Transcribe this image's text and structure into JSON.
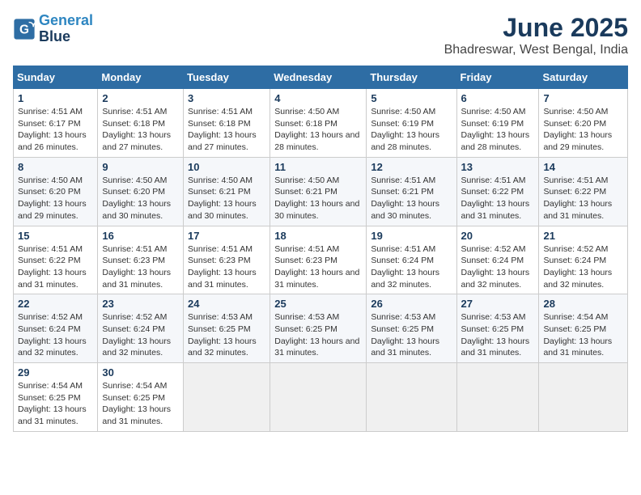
{
  "logo": {
    "line1": "General",
    "line2": "Blue"
  },
  "title": "June 2025",
  "subtitle": "Bhadreswar, West Bengal, India",
  "days_of_week": [
    "Sunday",
    "Monday",
    "Tuesday",
    "Wednesday",
    "Thursday",
    "Friday",
    "Saturday"
  ],
  "weeks": [
    [
      {
        "day": "1",
        "sunrise": "Sunrise: 4:51 AM",
        "sunset": "Sunset: 6:17 PM",
        "daylight": "Daylight: 13 hours and 26 minutes."
      },
      {
        "day": "2",
        "sunrise": "Sunrise: 4:51 AM",
        "sunset": "Sunset: 6:18 PM",
        "daylight": "Daylight: 13 hours and 27 minutes."
      },
      {
        "day": "3",
        "sunrise": "Sunrise: 4:51 AM",
        "sunset": "Sunset: 6:18 PM",
        "daylight": "Daylight: 13 hours and 27 minutes."
      },
      {
        "day": "4",
        "sunrise": "Sunrise: 4:50 AM",
        "sunset": "Sunset: 6:18 PM",
        "daylight": "Daylight: 13 hours and 28 minutes."
      },
      {
        "day": "5",
        "sunrise": "Sunrise: 4:50 AM",
        "sunset": "Sunset: 6:19 PM",
        "daylight": "Daylight: 13 hours and 28 minutes."
      },
      {
        "day": "6",
        "sunrise": "Sunrise: 4:50 AM",
        "sunset": "Sunset: 6:19 PM",
        "daylight": "Daylight: 13 hours and 28 minutes."
      },
      {
        "day": "7",
        "sunrise": "Sunrise: 4:50 AM",
        "sunset": "Sunset: 6:20 PM",
        "daylight": "Daylight: 13 hours and 29 minutes."
      }
    ],
    [
      {
        "day": "8",
        "sunrise": "Sunrise: 4:50 AM",
        "sunset": "Sunset: 6:20 PM",
        "daylight": "Daylight: 13 hours and 29 minutes."
      },
      {
        "day": "9",
        "sunrise": "Sunrise: 4:50 AM",
        "sunset": "Sunset: 6:20 PM",
        "daylight": "Daylight: 13 hours and 30 minutes."
      },
      {
        "day": "10",
        "sunrise": "Sunrise: 4:50 AM",
        "sunset": "Sunset: 6:21 PM",
        "daylight": "Daylight: 13 hours and 30 minutes."
      },
      {
        "day": "11",
        "sunrise": "Sunrise: 4:50 AM",
        "sunset": "Sunset: 6:21 PM",
        "daylight": "Daylight: 13 hours and 30 minutes."
      },
      {
        "day": "12",
        "sunrise": "Sunrise: 4:51 AM",
        "sunset": "Sunset: 6:21 PM",
        "daylight": "Daylight: 13 hours and 30 minutes."
      },
      {
        "day": "13",
        "sunrise": "Sunrise: 4:51 AM",
        "sunset": "Sunset: 6:22 PM",
        "daylight": "Daylight: 13 hours and 31 minutes."
      },
      {
        "day": "14",
        "sunrise": "Sunrise: 4:51 AM",
        "sunset": "Sunset: 6:22 PM",
        "daylight": "Daylight: 13 hours and 31 minutes."
      }
    ],
    [
      {
        "day": "15",
        "sunrise": "Sunrise: 4:51 AM",
        "sunset": "Sunset: 6:22 PM",
        "daylight": "Daylight: 13 hours and 31 minutes."
      },
      {
        "day": "16",
        "sunrise": "Sunrise: 4:51 AM",
        "sunset": "Sunset: 6:23 PM",
        "daylight": "Daylight: 13 hours and 31 minutes."
      },
      {
        "day": "17",
        "sunrise": "Sunrise: 4:51 AM",
        "sunset": "Sunset: 6:23 PM",
        "daylight": "Daylight: 13 hours and 31 minutes."
      },
      {
        "day": "18",
        "sunrise": "Sunrise: 4:51 AM",
        "sunset": "Sunset: 6:23 PM",
        "daylight": "Daylight: 13 hours and 31 minutes."
      },
      {
        "day": "19",
        "sunrise": "Sunrise: 4:51 AM",
        "sunset": "Sunset: 6:24 PM",
        "daylight": "Daylight: 13 hours and 32 minutes."
      },
      {
        "day": "20",
        "sunrise": "Sunrise: 4:52 AM",
        "sunset": "Sunset: 6:24 PM",
        "daylight": "Daylight: 13 hours and 32 minutes."
      },
      {
        "day": "21",
        "sunrise": "Sunrise: 4:52 AM",
        "sunset": "Sunset: 6:24 PM",
        "daylight": "Daylight: 13 hours and 32 minutes."
      }
    ],
    [
      {
        "day": "22",
        "sunrise": "Sunrise: 4:52 AM",
        "sunset": "Sunset: 6:24 PM",
        "daylight": "Daylight: 13 hours and 32 minutes."
      },
      {
        "day": "23",
        "sunrise": "Sunrise: 4:52 AM",
        "sunset": "Sunset: 6:24 PM",
        "daylight": "Daylight: 13 hours and 32 minutes."
      },
      {
        "day": "24",
        "sunrise": "Sunrise: 4:53 AM",
        "sunset": "Sunset: 6:25 PM",
        "daylight": "Daylight: 13 hours and 32 minutes."
      },
      {
        "day": "25",
        "sunrise": "Sunrise: 4:53 AM",
        "sunset": "Sunset: 6:25 PM",
        "daylight": "Daylight: 13 hours and 31 minutes."
      },
      {
        "day": "26",
        "sunrise": "Sunrise: 4:53 AM",
        "sunset": "Sunset: 6:25 PM",
        "daylight": "Daylight: 13 hours and 31 minutes."
      },
      {
        "day": "27",
        "sunrise": "Sunrise: 4:53 AM",
        "sunset": "Sunset: 6:25 PM",
        "daylight": "Daylight: 13 hours and 31 minutes."
      },
      {
        "day": "28",
        "sunrise": "Sunrise: 4:54 AM",
        "sunset": "Sunset: 6:25 PM",
        "daylight": "Daylight: 13 hours and 31 minutes."
      }
    ],
    [
      {
        "day": "29",
        "sunrise": "Sunrise: 4:54 AM",
        "sunset": "Sunset: 6:25 PM",
        "daylight": "Daylight: 13 hours and 31 minutes."
      },
      {
        "day": "30",
        "sunrise": "Sunrise: 4:54 AM",
        "sunset": "Sunset: 6:25 PM",
        "daylight": "Daylight: 13 hours and 31 minutes."
      },
      null,
      null,
      null,
      null,
      null
    ]
  ]
}
